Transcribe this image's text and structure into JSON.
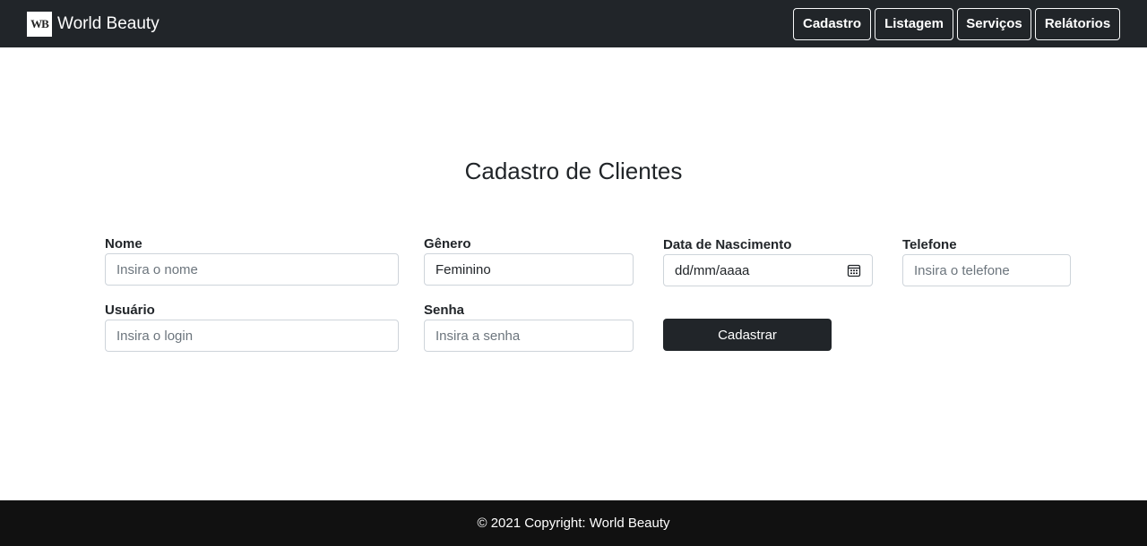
{
  "navbar": {
    "logo_text": "WB",
    "brand_name": "World Beauty",
    "links": [
      "Cadastro",
      "Listagem",
      "Serviços",
      "Relátorios"
    ]
  },
  "form": {
    "title": "Cadastro de Clientes",
    "nome": {
      "label": "Nome",
      "placeholder": "Insira o nome"
    },
    "genero": {
      "label": "Gênero",
      "value": "Feminino"
    },
    "nascimento": {
      "label": "Data de Nascimento",
      "value": "dd/mm/aaaa",
      "icon": "calendar-icon"
    },
    "telefone": {
      "label": "Telefone",
      "placeholder": "Insira o telefone"
    },
    "usuario": {
      "label": "Usuário",
      "placeholder": "Insira o login"
    },
    "senha": {
      "label": "Senha",
      "placeholder": "Insira a senha"
    },
    "submit_label": "Cadastrar"
  },
  "footer": {
    "text": "© 2021 Copyright: World Beauty"
  },
  "colors": {
    "dark": "#212529",
    "footer": "#111111",
    "border": "#ced4da"
  }
}
